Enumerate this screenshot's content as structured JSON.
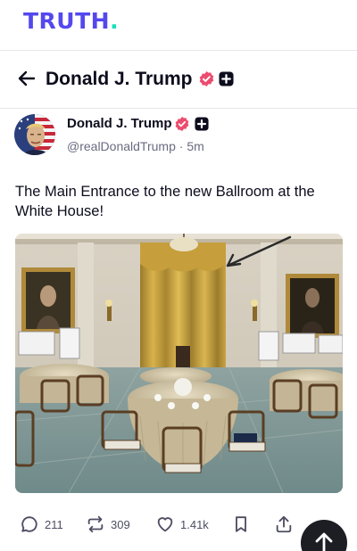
{
  "app": {
    "logo_text": "TRUTH",
    "logo_dot": ".",
    "brand_color": "#5448ee",
    "accent_color": "#17e0b9"
  },
  "profile_header": {
    "display_name": "Donald J. Trump",
    "back_icon": "arrow-left-icon"
  },
  "post": {
    "author_name": "Donald J. Trump",
    "handle": "@realDonaldTrump",
    "separator": "·",
    "time": "5m",
    "text": "The Main Entrance to the new Ballroom at the White House!",
    "verified_color": "#ec4c6e",
    "image_alt": "Formal ballroom with round tables set for dinner and gold curtains"
  },
  "actions": {
    "replies": "211",
    "retruths": "309",
    "likes": "1.41k",
    "bookmark_icon": "bookmark-icon",
    "share_icon": "share-icon"
  },
  "scroll_top_icon": "arrow-up-icon"
}
